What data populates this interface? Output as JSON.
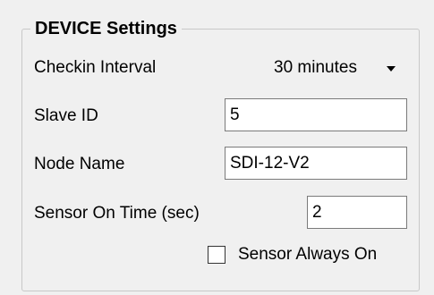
{
  "group": {
    "title": "DEVICE Settings"
  },
  "checkin_interval": {
    "label": "Checkin Interval",
    "value": "30 minutes"
  },
  "slave_id": {
    "label": "Slave ID",
    "value": "5"
  },
  "node_name": {
    "label": "Node Name",
    "value": "SDI-12-V2"
  },
  "sensor_on_time": {
    "label": "Sensor On Time (sec)",
    "value": "2"
  },
  "sensor_always_on": {
    "label": "Sensor Always On",
    "checked": false
  },
  "icons": {
    "combo_arrow": "chevron-down-icon"
  }
}
